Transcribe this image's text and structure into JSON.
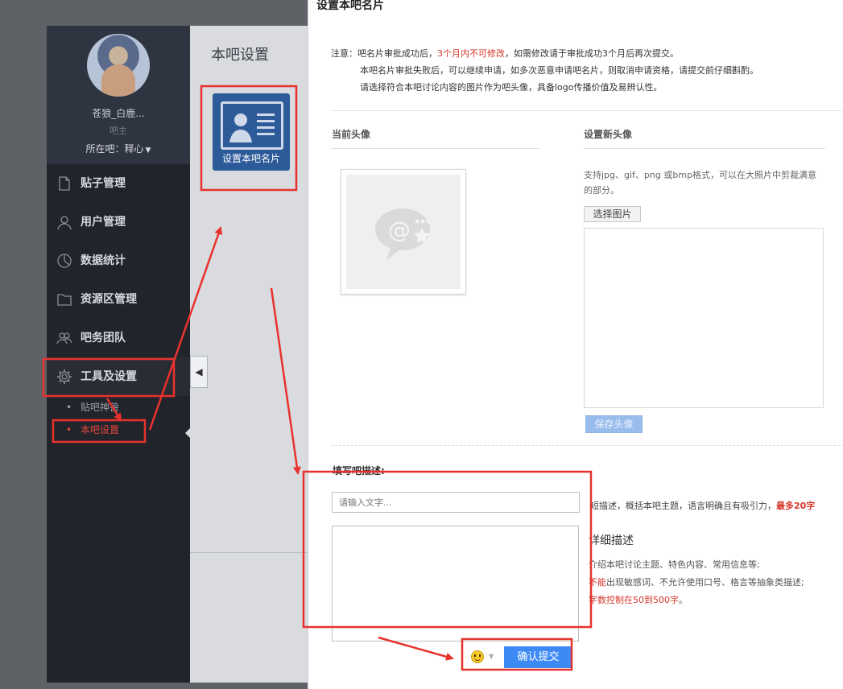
{
  "sidebar": {
    "username": "苍狼_白鹿...",
    "role": "吧主",
    "current_bar_label": "所在吧：释心",
    "nav_items": [
      {
        "label": "贴子管理",
        "icon": "document-icon"
      },
      {
        "label": "用户管理",
        "icon": "user-icon"
      },
      {
        "label": "数据统计",
        "icon": "chart-pie-icon"
      },
      {
        "label": "资源区管理",
        "icon": "folder-icon"
      },
      {
        "label": "吧务团队",
        "icon": "team-icon"
      },
      {
        "label": "工具及设置",
        "icon": "gear-icon"
      }
    ],
    "sub_items": [
      {
        "label": "贴吧神兽",
        "active": false
      },
      {
        "label": "本吧设置",
        "active": true
      }
    ]
  },
  "content": {
    "title": "本吧设置",
    "tile_label": "设置本吧名片",
    "collapse_glyph": "◀"
  },
  "modal": {
    "title": "设置本吧名片",
    "notice": {
      "prefix": "注意：",
      "line1_a": "吧名片审批成功后，",
      "line1_red": "3个月内不可修改",
      "line1_b": "，如需修改请于审批成功3个月后再次提交。",
      "line2": "本吧名片审批失败后，可以继续申请，如多次恶意申请吧名片，则取消申请资格，请提交前仔细斟酌。",
      "line3": "请选择符合本吧讨论内容的图片作为吧头像，具备logo传播价值及易辨认性。"
    },
    "current_avatar_label": "当前头像",
    "new_avatar_label": "设置新头像",
    "upload_hint": "支持jpg、gif、png 或bmp格式，可以在大照片中剪裁满意的部分。",
    "choose_image_label": "选择图片",
    "save_avatar_label": "保存头像",
    "desc_section_label": "填写吧描述:",
    "short_desc_placeholder": "请输入文字...",
    "short_hint": "短描述，概括本吧主题，语言明确且有吸引力，",
    "short_hint_red": "最多20字",
    "long_desc_label": "详细描述",
    "long_hint_line1": "介绍本吧讨论主题、特色内容、常用信息等;",
    "long_hint_line2_red": "不能",
    "long_hint_line2": "出现敏感词、不允许使用口号、格言等抽象类描述;",
    "long_hint_line3_red": "字数控制在50到500字",
    "long_hint_line3_end": "。",
    "submit_label": "确认提交"
  },
  "colors": {
    "annotation_red": "#e8322d",
    "sidebar_bg": "#22242b",
    "accent_blue": "#3d8af5",
    "warning_red": "#d3352a"
  }
}
